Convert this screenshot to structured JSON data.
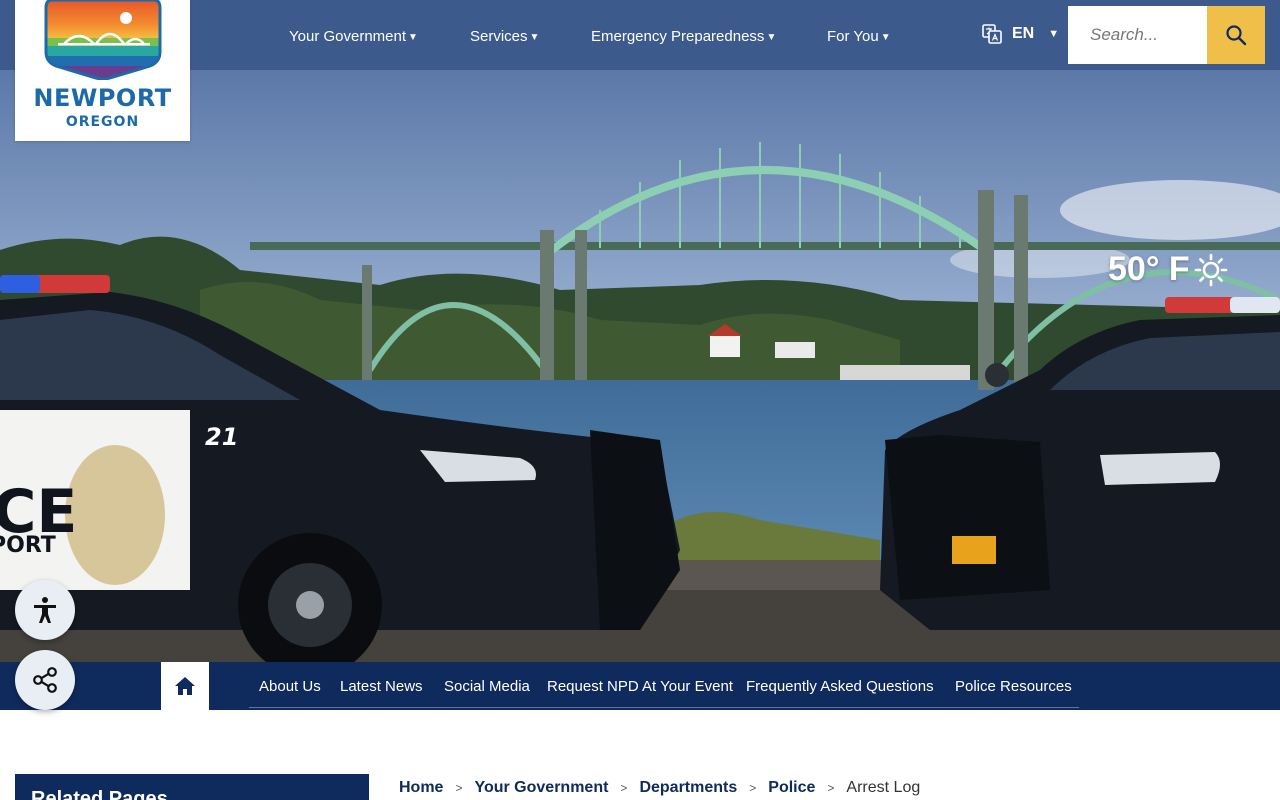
{
  "logo": {
    "name": "NEWPORT",
    "sub": "OREGON"
  },
  "main_nav": [
    {
      "label": "Your Government"
    },
    {
      "label": "Services"
    },
    {
      "label": "Emergency Preparedness"
    },
    {
      "label": "For You"
    }
  ],
  "language": {
    "label": "EN"
  },
  "search": {
    "placeholder": "Search..."
  },
  "weather": {
    "temp": "50° F",
    "icon": "sun-icon"
  },
  "sub_nav": [
    {
      "label": "About Us"
    },
    {
      "label": "Latest News"
    },
    {
      "label": "Social Media"
    },
    {
      "label": "Request NPD At Your Event"
    },
    {
      "label": "Frequently Asked Questions"
    },
    {
      "label": "Police Resources"
    }
  ],
  "sidebar": {
    "title": "Related Pages"
  },
  "breadcrumb": {
    "items": [
      "Home",
      "Your Government",
      "Departments",
      "Police"
    ],
    "current": "Arrest Log"
  },
  "hero_text": {
    "car_number": "21",
    "car_label_1": "ICE",
    "car_label_2": "PORT"
  },
  "colors": {
    "header": "#3d5a8c",
    "subnav": "#0f2a5c",
    "accent": "#f0bf4a"
  }
}
